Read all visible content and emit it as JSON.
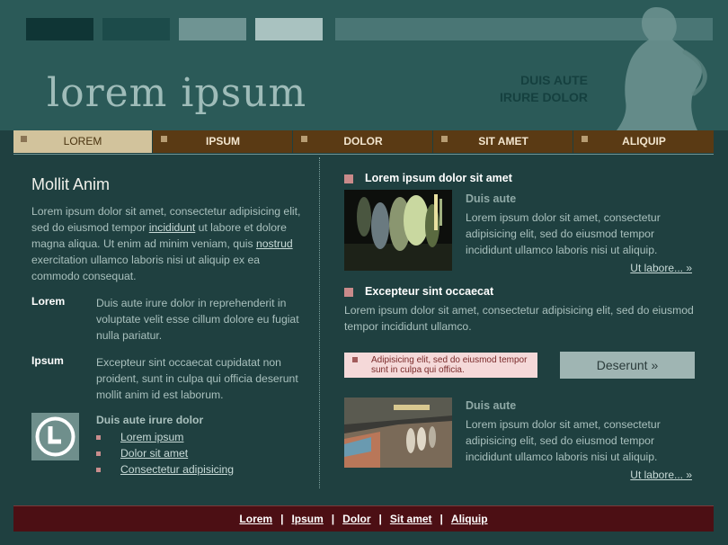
{
  "header": {
    "logo": "lorem ipsum",
    "tagline_line1": "DUIS AUTE",
    "tagline_line2": "IRURE DOLOR"
  },
  "nav": {
    "items": [
      "LOREM",
      "IPSUM",
      "DOLOR",
      "SIT AMET",
      "ALIQUIP"
    ],
    "active_index": 0
  },
  "left": {
    "heading": "Mollit Anim",
    "intro_part1": "Lorem ipsum dolor sit amet, consectetur adipisicing elit, sed do eiusmod tempor ",
    "intro_link1": "incididunt",
    "intro_part2": " ut labore et dolore magna aliqua. Ut enim ad minim veniam, quis ",
    "intro_link2": "nostrud",
    "intro_part3": " exercitation ullamco laboris nisi ut aliquip ex ea commodo consequat.",
    "definitions": [
      {
        "term": "Lorem",
        "desc": "Duis aute irure dolor in reprehenderit in voluptate velit esse cillum dolore eu fugiat nulla pariatur."
      },
      {
        "term": "Ipsum",
        "desc": "Excepteur sint occaecat cupidatat non proident, sunt in culpa qui officia deserunt mollit anim id est laborum."
      }
    ],
    "links_title": "Duis aute irure dolor",
    "links": [
      "Lorem ipsum",
      "Dolor sit amet",
      "Consectetur adipisicing"
    ]
  },
  "right": {
    "section1_title": "Lorem ipsum dolor sit amet",
    "card1": {
      "title": "Duis aute",
      "text": "Lorem ipsum dolor sit amet, consectetur adipisicing elit, sed do eiusmod tempor incididunt ullamco laboris nisi ut aliquip.",
      "more": "Ut labore... »"
    },
    "section2_title": "Excepteur sint occaecat",
    "section2_text": "Lorem ipsum dolor sit amet, consectetur adipisicing elit, sed do eiusmod tempor incididunt ullamco.",
    "notice": "Adipisicing elit, sed do eiusmod tempor sunt in culpa qui officia.",
    "button": "Deserunt »",
    "card2": {
      "title": "Duis aute",
      "text": "Lorem ipsum dolor sit amet, consectetur adipisicing elit, sed do eiusmod tempor incididunt ullamco laboris nisi ut aliquip.",
      "more": "Ut labore... »"
    }
  },
  "footer": {
    "links": [
      "Lorem",
      "Ipsum",
      "Dolor",
      "Sit amet",
      "Aliquip"
    ],
    "separator": "|"
  },
  "colors": {
    "background": "#1f4040",
    "header": "#2b5a58",
    "nav": "#5a3a14",
    "nav_active": "#d2c39c",
    "footer": "#4c0f14",
    "bullet": "#c98a8a",
    "notice_bg": "#f5d9d9",
    "button_bg": "#9fb5b3"
  }
}
